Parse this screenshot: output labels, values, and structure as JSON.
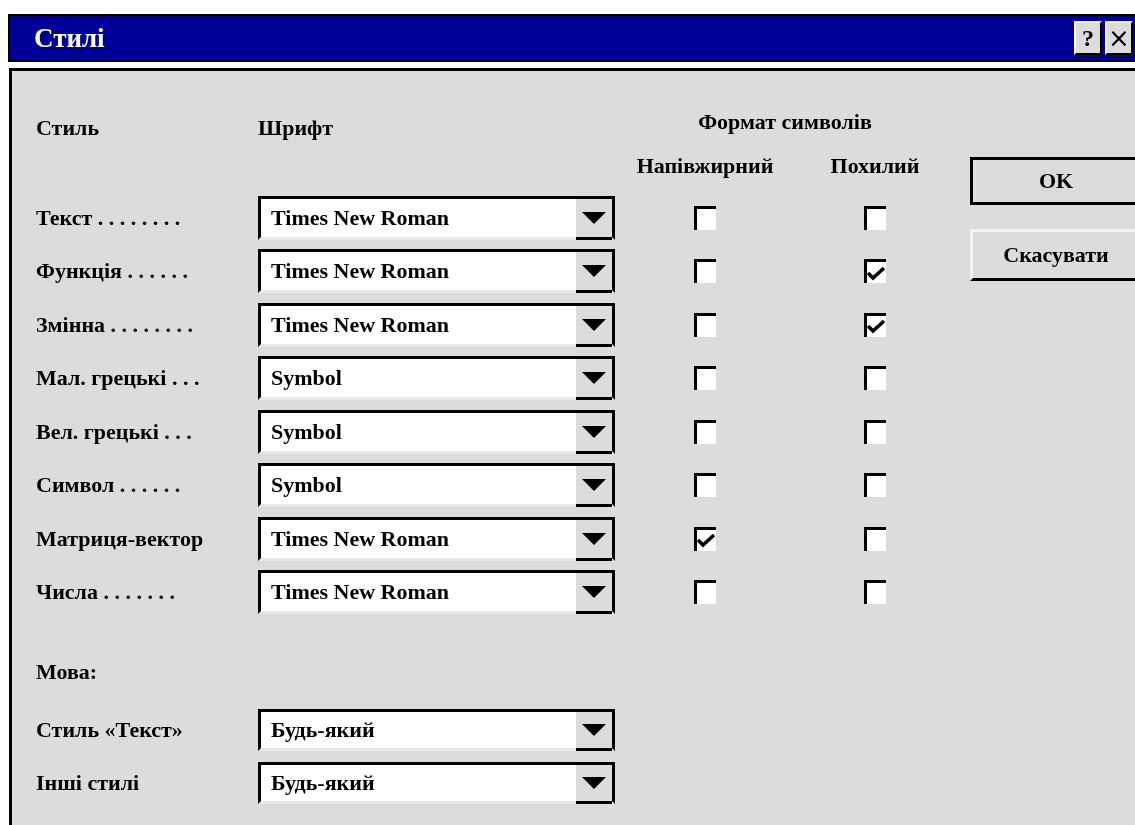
{
  "window": {
    "title": "Стилі",
    "buttons": [
      {
        "kind": "help",
        "label": "?"
      },
      {
        "kind": "close",
        "label": "×"
      }
    ]
  },
  "headers": {
    "style": "Стиль",
    "font": "Шрифт",
    "format": "Формат символів",
    "bold": "Напівжирний",
    "italic": "Похилий"
  },
  "styles": [
    {
      "name": "Текст . . . . . . . .",
      "font": "Times New Roman",
      "bold": false,
      "italic": false
    },
    {
      "name": "Функція . . . . . .",
      "font": "Times New Roman",
      "bold": false,
      "italic": true
    },
    {
      "name": "Змінна . . . . . . . .",
      "font": "Times New Roman",
      "bold": false,
      "italic": true
    },
    {
      "name": "Мал. грецькі . . .",
      "font": "Symbol",
      "bold": false,
      "italic": false
    },
    {
      "name": "Вел. грецькі . . .",
      "font": "Symbol",
      "bold": false,
      "italic": false
    },
    {
      "name": "Символ . . . . . .",
      "font": "Symbol",
      "bold": false,
      "italic": false
    },
    {
      "name": "Матриця-вектор",
      "font": "Times New Roman",
      "bold": true,
      "italic": false
    },
    {
      "name": "Числа . . . . . . .",
      "font": "Times New Roman",
      "bold": false,
      "italic": false
    }
  ],
  "language": {
    "label": "Мова:",
    "rows": [
      {
        "name": "Стиль «Текст»",
        "value": "Будь-який"
      },
      {
        "name": "Інші стилі",
        "value": "Будь-який"
      }
    ]
  },
  "buttons": [
    {
      "kind": "default",
      "label": "OK"
    },
    {
      "kind": "normal",
      "label": "Скасувати"
    }
  ]
}
